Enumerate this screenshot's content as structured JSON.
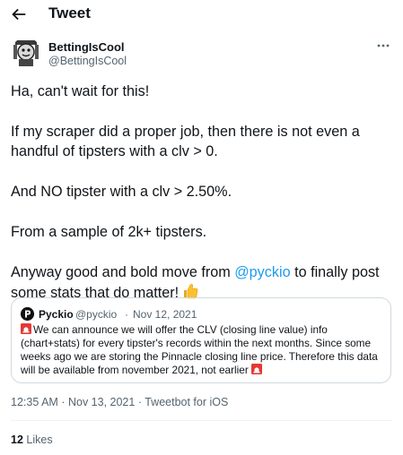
{
  "header": {
    "back_icon": "arrow-left-icon",
    "title": "Tweet"
  },
  "author": {
    "display_name": "BettingIsCool",
    "handle": "@BettingIsCool",
    "more_icon": "more-horizontal-icon"
  },
  "tweet": {
    "lines": [
      "Ha, can't wait for this!",
      "If my scraper did a proper job, then there is not even a handful of tipsters with a clv > 0.",
      "And NO tipster with a clv > 2.50%.",
      "From a sample of 2k+ tipsters."
    ],
    "last_prefix": "Anyway good and bold move from ",
    "mention": "@pyckio",
    "last_suffix": " to finally post some stats that do matter!",
    "emoji": "thumbs-up-icon"
  },
  "quote": {
    "name": "Pyckio",
    "handle": "@pyckio",
    "separator": "·",
    "date": "Nov 12, 2021",
    "text": "We can announce we will offer the CLV (closing line value) info (chart+stats) for every tipster's records within the next months. Since some weeks ago we are storing the Pinnacle closing line price. Therefore this data will be available from november 2021, not earlier",
    "emoji": "police-light-icon"
  },
  "meta": {
    "time": "12:35 AM",
    "separator": "·",
    "date": "Nov 13, 2021",
    "source": "Tweetbot for iOS"
  },
  "stats": {
    "likes_count": "12",
    "likes_label": "Likes"
  },
  "colors": {
    "accent": "#1d9bf0",
    "text": "#0f1419",
    "secondary": "#536471",
    "border": "#cfd9de"
  }
}
